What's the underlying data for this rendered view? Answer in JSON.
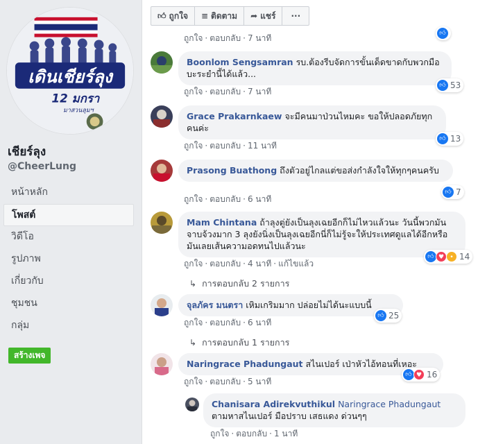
{
  "sidebar": {
    "logo_title": "เดินเชียร์ลุง",
    "logo_subtitle": "12 มกรา",
    "logo_caption": "มาสวนลุมฯ",
    "page_name": "เชียร์ลุง",
    "handle": "@CheerLung",
    "nav": [
      "หน้าหลัก",
      "โพสต์",
      "วิดีโอ",
      "รูปภาพ",
      "เกี่ยวกับ",
      "ชุมชน",
      "กลุ่ม"
    ],
    "create_button": "สร้างเพจ"
  },
  "actionbar": {
    "like": "ถูกใจ",
    "follow": "ติดตาม",
    "share": "แชร์",
    "more": "···"
  },
  "comments": [
    {
      "meta_top": {
        "like": "ถูกใจ",
        "reply": "ตอบกลับ",
        "time": "7 นาที"
      }
    },
    {
      "name": "Boonlom Sengsamran",
      "text": "รบ.ต้องรีบจัดการขั้นเด็ดขาดกับพวกมือบะระยำนี้ได้แล้ว...",
      "like": "ถูกใจ",
      "reply": "ตอบกลับ",
      "time": "7 นาที",
      "reactions": "53"
    },
    {
      "name": "Grace Prakarnkaew",
      "text": "จะมีคนมาป่วนไหมคะ ขอให้ปลอดภัยทุกคนค่ะ",
      "like": "ถูกใจ",
      "reply": "ตอบกลับ",
      "time": "11 นาที",
      "reactions": "13"
    },
    {
      "name": "Prasong Buathong",
      "text": "ถึงตัวอยู่ไกลแต่ขอส่งกำลังใจให้ทุกๆคนครับ",
      "like": "ถูกใจ",
      "reply": "ตอบกลับ",
      "time": "6 นาที",
      "reactions": "7"
    },
    {
      "name": "Mam Chintana",
      "text": "ถ้าลุงตู่ยังเป็นลุงเฉยอีกก็ไม่ไหวแล้วนะ วันนี้พวกมันจาบจ้วงมาก 3 ลุงยังนิ่งเป็นลุงเฉยอีกนี่ก็ไม่รู้จะให้ประเทศดูแลได้อีกหรือ มันเลยเส้นความอดทนไปแล้วนะ",
      "like": "ถูกใจ",
      "reply": "ตอบกลับ",
      "time": "4 นาที",
      "edited": "แก้ไขแล้ว",
      "reactions": "14",
      "replies_link": "การตอบกลับ 2 รายการ"
    },
    {
      "name": "จุลภัคร มนตรา",
      "text": "เหิมเกริมมาก ปล่อยไม่ได้นะแบบนี้",
      "like": "ถูกใจ",
      "reply": "ตอบกลับ",
      "time": "6 นาที",
      "reactions": "25",
      "replies_link": "การตอบกลับ 1 รายการ"
    },
    {
      "name": "Naringrace Phadungaut",
      "text": "สไนเปอร์ เป่าหัวไอ้ทอนที่เหอะ",
      "like": "ถูกใจ",
      "reply": "ตอบกลับ",
      "time": "5 นาที",
      "reactions": "16"
    },
    {
      "name": "Chanisara Adirekvuthikul",
      "mention": "Naringrace Phadungaut",
      "text": "ตามหาสไนเปอร์ มือปราบ เสธแดง ด่วนๆๆ",
      "like": "ถูกใจ",
      "reply": "ตอบกลับ",
      "time": "1 นาที"
    }
  ],
  "colors": {
    "name_link": "#385898",
    "bubble_bg": "#f2f3f5",
    "like_blue": "#1877f2",
    "create_green": "#42b72a"
  }
}
